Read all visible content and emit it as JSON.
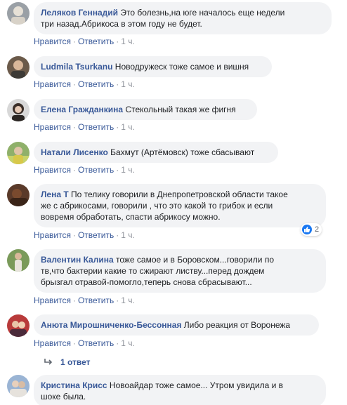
{
  "comments": [
    {
      "author": "Леляков Геннадий",
      "text_1": " Это болезнь,на юге началось еще недели",
      "text_2": "три назад.Абрикоса в этом году не будет.",
      "like": "Нравится",
      "reply": "Ответить",
      "time": "1 ч."
    },
    {
      "author": "Ludmila Tsurkanu",
      "text_1": " Новодружеск тоже самое и вишня",
      "like": "Нравится",
      "reply": "Ответить",
      "time": "1 ч."
    },
    {
      "author": "Елена Гражданкина",
      "text_1": " Стекольный такая же фигня",
      "like": "Нравится",
      "reply": "Ответить",
      "time": "1 ч."
    },
    {
      "author": "Натали Лисенко",
      "text_1": " Бахмут (Артёмовск) тоже сбасывают",
      "like": "Нравится",
      "reply": "Ответить",
      "time": "1 ч."
    },
    {
      "author": "Лена Т",
      "text_1": " По телику говорили в Днепропетровской области такое",
      "text_2": "же с абрикосами, говорили , что это какой то грибок и если",
      "text_3": "вовремя обработать, спасти абрикосу можно.",
      "like": "Нравится",
      "reply": "Ответить",
      "time": "1 ч.",
      "reaction_count": "2",
      "reaction_icon": "like-icon"
    },
    {
      "author": "Валентин Калина",
      "text_1": " тоже самое и в Боровском...говорили по",
      "text_2": "тв,что бактерии какие то сжирают листву...перед дождем",
      "text_3": "брызгал отравой-помогло,теперь снова сбрасывают...",
      "like": "Нравится",
      "reply": "Ответить",
      "time": "1 ч."
    },
    {
      "author": "Анюта Мирошниченко-Бессонная",
      "text_1": " Либо реакция от Воронежа",
      "like": "Нравится",
      "reply": "Ответить",
      "time": "1 ч.",
      "replies_label": "1 ответ"
    },
    {
      "author": "Кристина Крисс",
      "text_1": " Новоайдар тоже самое... Утром увидила и в",
      "text_2": "шоке была."
    }
  ],
  "separator": "·",
  "colors": {
    "author": "#385898",
    "bubble": "#f2f3f5",
    "meta": "#90949c",
    "like_blue": "#1877f2"
  }
}
